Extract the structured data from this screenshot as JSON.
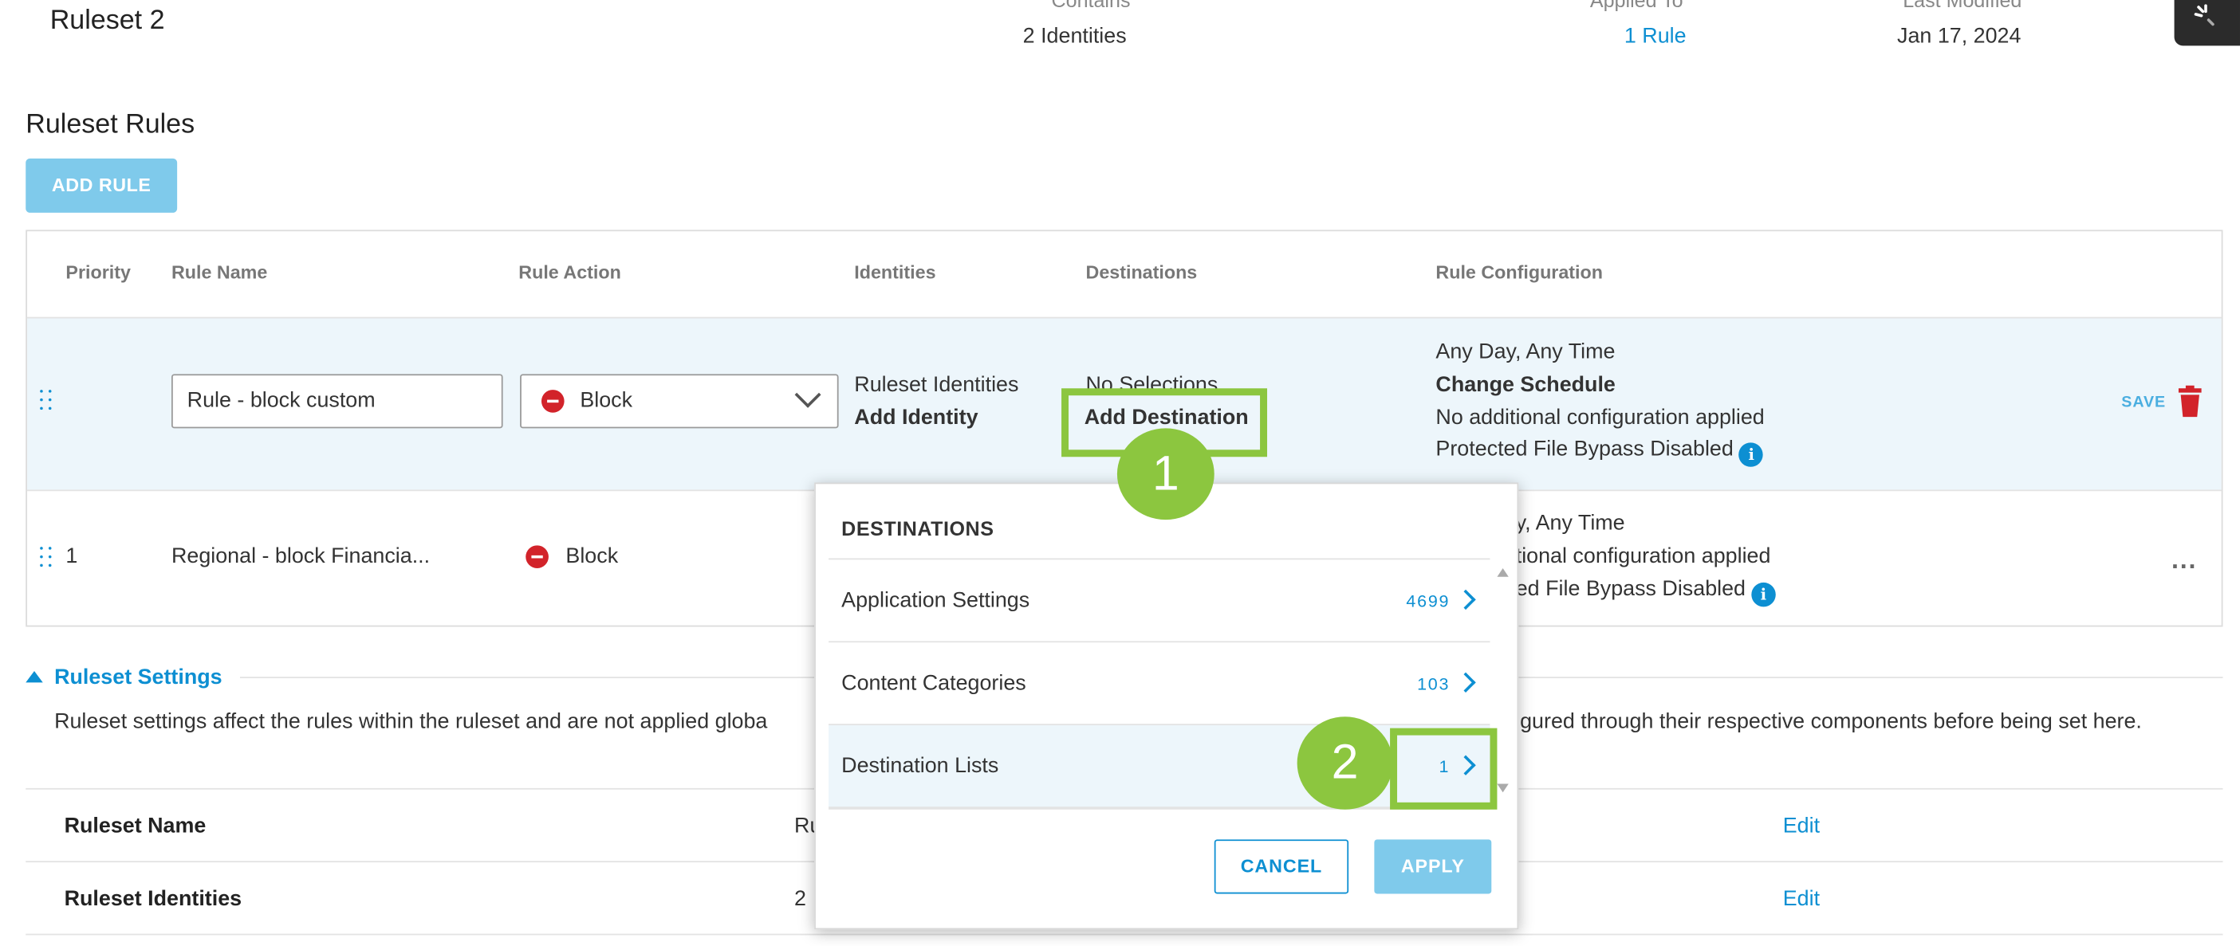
{
  "ruleset": {
    "name": "Ruleset 2",
    "contains_label": "Contains",
    "contains_value": "2 Identities",
    "applied_label": "Applied To",
    "applied_value": "1 Rule",
    "modified_label": "Last Modified",
    "modified_value": "Jan 17, 2024"
  },
  "rules_section": {
    "title": "Ruleset Rules",
    "add_rule_label": "ADD RULE"
  },
  "table": {
    "headers": [
      "Priority",
      "Rule Name",
      "Rule Action",
      "Identities",
      "Destinations",
      "Rule Configuration"
    ],
    "edit_row": {
      "rule_name_value": "Rule - block custom",
      "action_value": "Block",
      "identities_text": "Ruleset Identities",
      "add_identity_label": "Add Identity",
      "destinations_text": "No Selections",
      "add_destination_label": "Add Destination",
      "config_schedule": "Any Day, Any Time",
      "change_schedule_label": "Change Schedule",
      "config_additional": "No additional configuration applied",
      "config_bypass": "Protected File Bypass Disabled",
      "save_label": "SAVE"
    },
    "row1": {
      "priority": "1",
      "rule_name": "Regional - block Financia...",
      "action": "Block",
      "config_schedule": "y, Any Time",
      "config_additional": "tional configuration applied",
      "config_bypass": "ed File Bypass Disabled",
      "more_label": "..."
    }
  },
  "settings": {
    "title": "Ruleset Settings",
    "description_left": "Ruleset settings affect the rules within the ruleset and are not applied globa",
    "description_right": "gured through their respective components before being set here.",
    "rows": [
      {
        "label": "Ruleset Name",
        "value": "Ru",
        "edit": "Edit"
      },
      {
        "label": "Ruleset Identities",
        "value": "2",
        "edit": "Edit"
      }
    ]
  },
  "destinations_popup": {
    "title": "DESTINATIONS",
    "items": [
      {
        "label": "Application Settings",
        "count": "4699"
      },
      {
        "label": "Content Categories",
        "count": "103"
      },
      {
        "label": "Destination Lists",
        "count": "1"
      }
    ],
    "cancel_label": "CANCEL",
    "apply_label": "APPLY"
  },
  "callouts": [
    "1",
    "2"
  ],
  "icons": {
    "block": "minus-circle-icon",
    "trash": "trash-icon",
    "info": "info-icon",
    "chevron": "chevron-right-icon",
    "drag": "drag-handle-icon",
    "spinner": "spinner-icon"
  },
  "colors": {
    "accent": "#0d8fd2",
    "block_red": "#d2232a",
    "callout_green": "#8cc63f",
    "row_highlight": "#edf6fb",
    "button_light_blue": "#7fcaeb"
  }
}
